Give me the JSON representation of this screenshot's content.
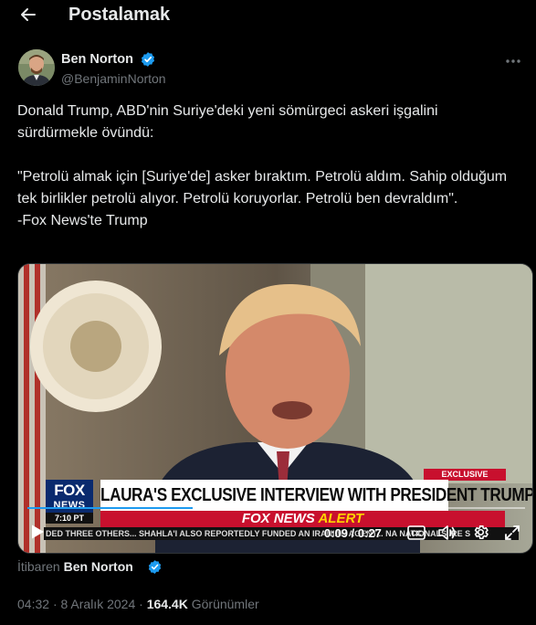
{
  "header": {
    "title": "Postalamak",
    "back_icon": "arrow-left-icon"
  },
  "author": {
    "name": "Ben Norton",
    "handle": "@BenjaminNorton",
    "verified": true,
    "verified_color": "#1d9bf0"
  },
  "tweet": {
    "text": "Donald Trump, ABD'nin Suriye'deki yeni sömürgeci askeri işgalini sürdürmekle övündü:\n\n\"Petrolü almak için [Suriye'de] asker bıraktım. Petrolü aldım. Sahip olduğum tek birlikler petrolü alıyor. Petrolü koruyorlar. Petrolü ben devraldım\".\n-Fox News'te Trump"
  },
  "video": {
    "chyron": "LAURA'S EXCLUSIVE INTERVIEW WITH PRESIDENT TRUMP",
    "exclusive_tag": "EXCLUSIVE",
    "logo_line1": "FOX",
    "logo_line2": "NEWS",
    "logo_time": "7:10 PT",
    "alert_prefix": "FOX NEWS",
    "alert_suffix": "ALERT",
    "ticker": "DED THREE OTHERS...    SHAHLA'I ALSO REPORTEDLY FUNDED AN IRANIAN AGENT...    NA NATIONALS    IRE S",
    "current_time": "0:09",
    "duration": "0:27",
    "progress_fraction": 0.333,
    "progress_color": "#1d9bf0"
  },
  "attribution": {
    "prefix": "İtibaren",
    "name": "Ben Norton"
  },
  "meta": {
    "time": "04:32",
    "sep": "·",
    "date": "8 Aralık 2024",
    "views": "164.4K",
    "views_label": "Görünümler"
  }
}
